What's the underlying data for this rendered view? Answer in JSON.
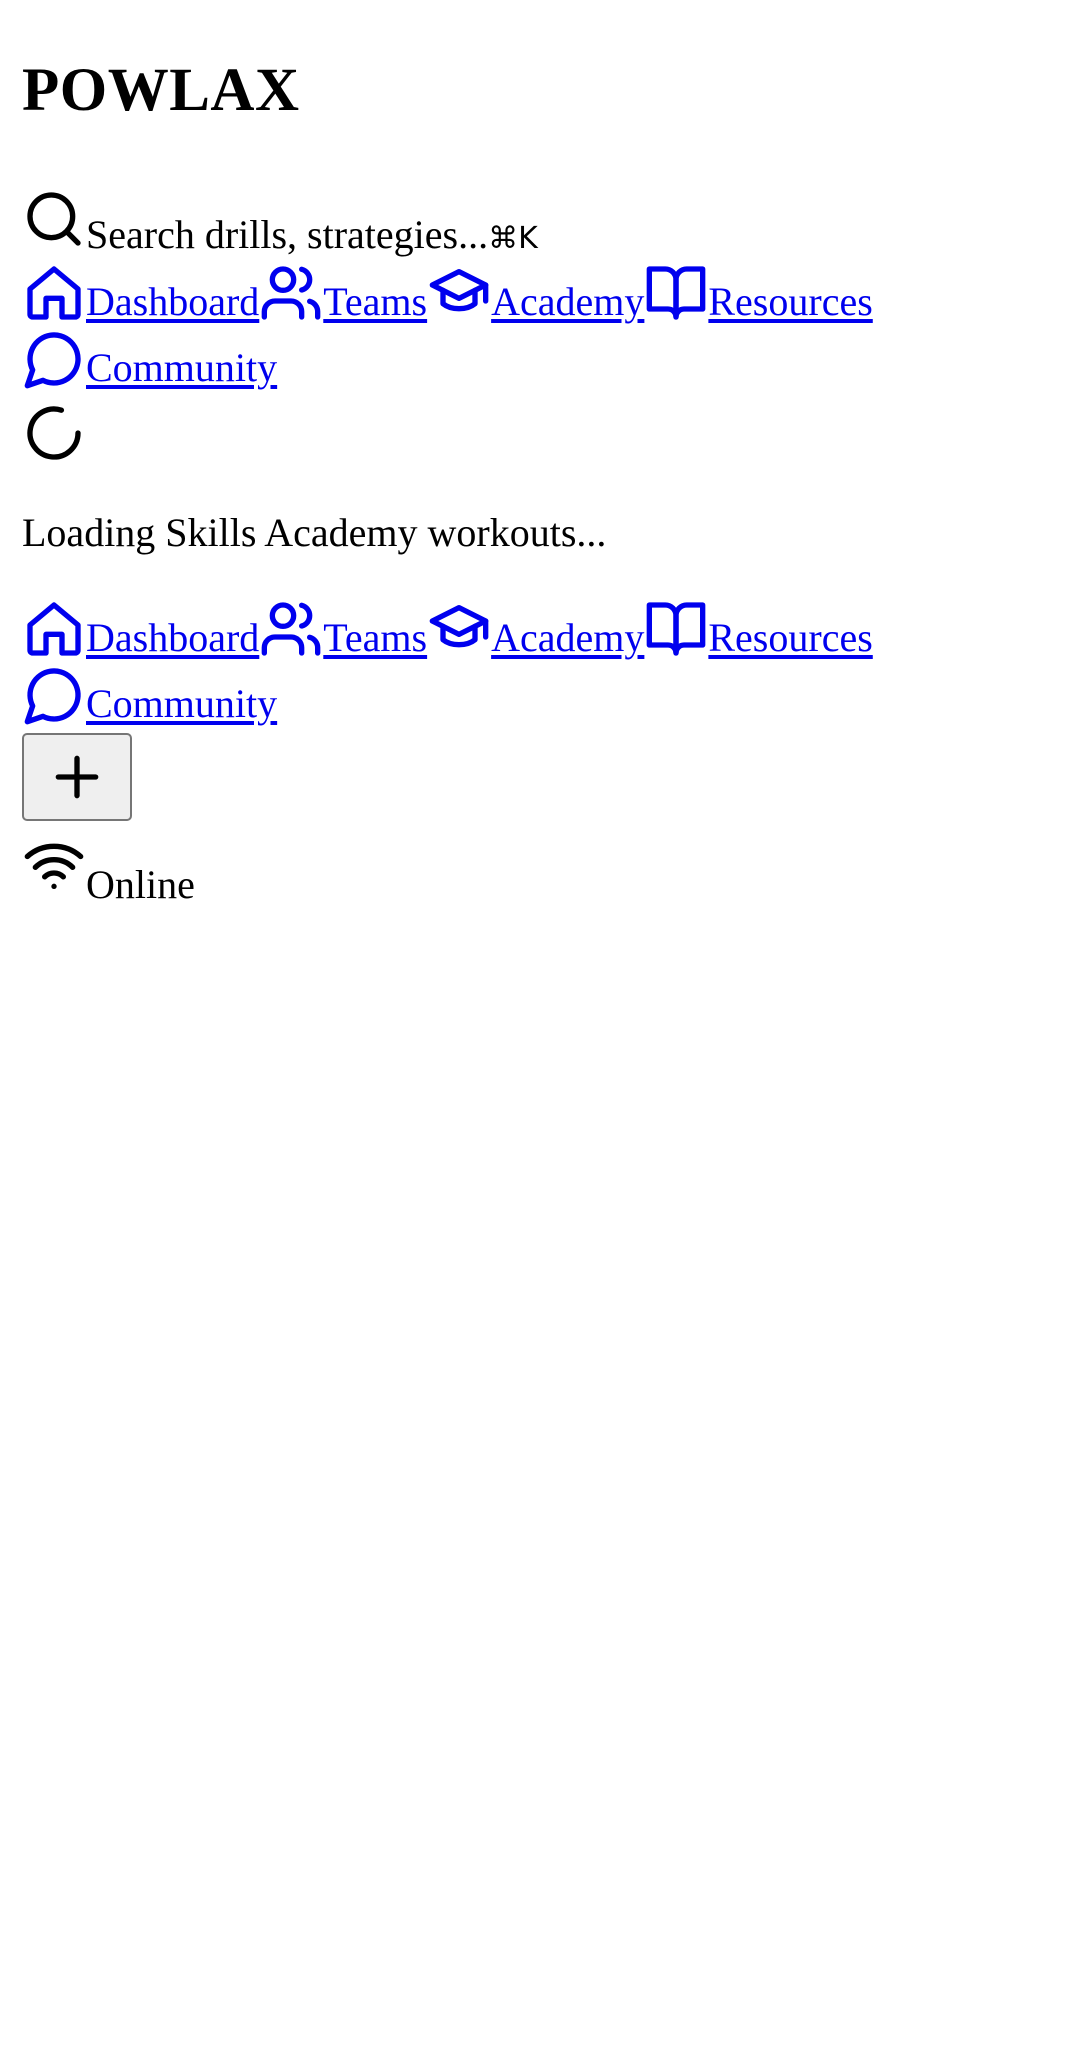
{
  "header": {
    "brand": "POWLAX"
  },
  "search": {
    "placeholder": "Search drills, strategies...",
    "shortcut": "⌘K",
    "icon": "search-icon"
  },
  "nav": {
    "link_color": "#0000ee",
    "items": [
      {
        "label": "Dashboard",
        "icon": "home-icon"
      },
      {
        "label": "Teams",
        "icon": "users-icon"
      },
      {
        "label": "Academy",
        "icon": "graduation-cap-icon"
      },
      {
        "label": "Resources",
        "icon": "book-open-icon"
      },
      {
        "label": "Community",
        "icon": "message-circle-icon"
      }
    ]
  },
  "main": {
    "loading_text": "Loading Skills Academy workouts...",
    "spinner_icon": "loader-icon"
  },
  "bottom_nav": {
    "items": [
      {
        "label": "Dashboard",
        "icon": "home-icon"
      },
      {
        "label": "Teams",
        "icon": "users-icon"
      },
      {
        "label": "Academy",
        "icon": "graduation-cap-icon"
      },
      {
        "label": "Resources",
        "icon": "book-open-icon"
      },
      {
        "label": "Community",
        "icon": "message-circle-icon"
      }
    ]
  },
  "fab": {
    "icon": "plus-icon"
  },
  "status": {
    "label": "Online",
    "icon": "wifi-icon"
  }
}
